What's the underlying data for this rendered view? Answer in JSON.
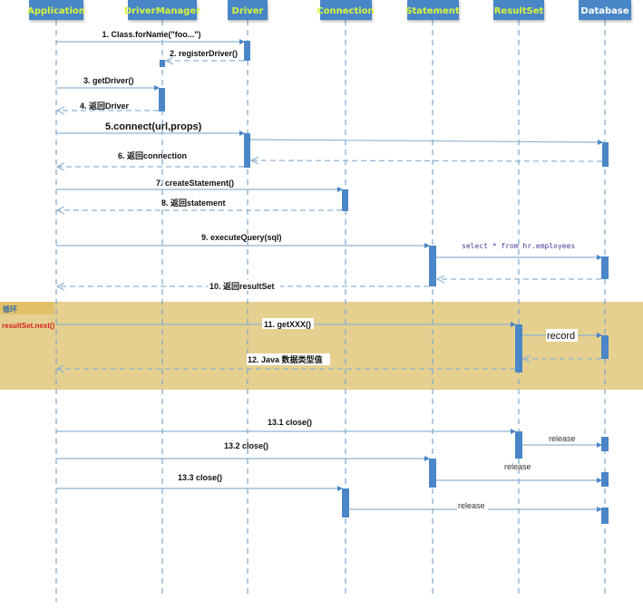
{
  "participants": [
    {
      "id": "app",
      "label": "Application",
      "color": "#d7f53a"
    },
    {
      "id": "dm",
      "label": "DriverManager",
      "color": "#d7f53a"
    },
    {
      "id": "drv",
      "label": "Driver",
      "color": "#d7f53a"
    },
    {
      "id": "conn",
      "label": "Connection",
      "color": "#d7f53a"
    },
    {
      "id": "stmt",
      "label": "Statement",
      "color": "#d7f53a"
    },
    {
      "id": "rs",
      "label": "ResultSet",
      "color": "#d7f53a"
    },
    {
      "id": "db",
      "label": "Database",
      "color": "#ffffff"
    }
  ],
  "messages": [
    {
      "label": "1. Class.forName(\"foo...\")",
      "from": "app",
      "to": "drv",
      "type": "call"
    },
    {
      "label": "2. registerDriver()",
      "from": "drv",
      "to": "dm",
      "type": "return"
    },
    {
      "label": "3. getDriver()",
      "from": "app",
      "to": "dm",
      "type": "call"
    },
    {
      "label": "4. 返回Driver",
      "from": "dm",
      "to": "app",
      "type": "return"
    },
    {
      "label": "5.connect(url,props)",
      "from": "app",
      "to": "drv",
      "type": "call"
    },
    {
      "label": "",
      "from": "drv",
      "to": "db",
      "type": "call"
    },
    {
      "label": "",
      "from": "db",
      "to": "drv",
      "type": "return"
    },
    {
      "label": "6. 返回connection",
      "from": "drv",
      "to": "app",
      "type": "return"
    },
    {
      "label": "7. createStatement()",
      "from": "app",
      "to": "conn",
      "type": "call"
    },
    {
      "label": "8.  返回statement",
      "from": "conn",
      "to": "app",
      "type": "return"
    },
    {
      "label": "9. executeQuery(sql)",
      "from": "app",
      "to": "stmt",
      "type": "call"
    },
    {
      "label": "select * from hr.employees",
      "from": "stmt",
      "to": "db",
      "type": "call"
    },
    {
      "label": "",
      "from": "db",
      "to": "stmt",
      "type": "return"
    },
    {
      "label": "10. 返回resultSet",
      "from": "stmt",
      "to": "app",
      "type": "return"
    },
    {
      "label": "11. getXXX()",
      "from": "app",
      "to": "rs",
      "type": "call"
    },
    {
      "label": "record",
      "from": "rs",
      "to": "db",
      "type": "call"
    },
    {
      "label": "",
      "from": "db",
      "to": "rs",
      "type": "return"
    },
    {
      "label": "12. Java 数据类型值",
      "from": "rs",
      "to": "app",
      "type": "return"
    },
    {
      "label": "13.1  close()",
      "from": "app",
      "to": "rs",
      "type": "call"
    },
    {
      "label": "release",
      "from": "rs",
      "to": "db",
      "type": "call"
    },
    {
      "label": "13.2  close()",
      "from": "app",
      "to": "stmt",
      "type": "call"
    },
    {
      "label": "release",
      "from": "stmt",
      "to": "db",
      "type": "call"
    },
    {
      "label": "13.3 close()",
      "from": "app",
      "to": "conn",
      "type": "call"
    },
    {
      "label": "release",
      "from": "conn",
      "to": "db",
      "type": "call"
    }
  ],
  "loop": {
    "title": "循环",
    "condition": "resultSet.next()"
  }
}
